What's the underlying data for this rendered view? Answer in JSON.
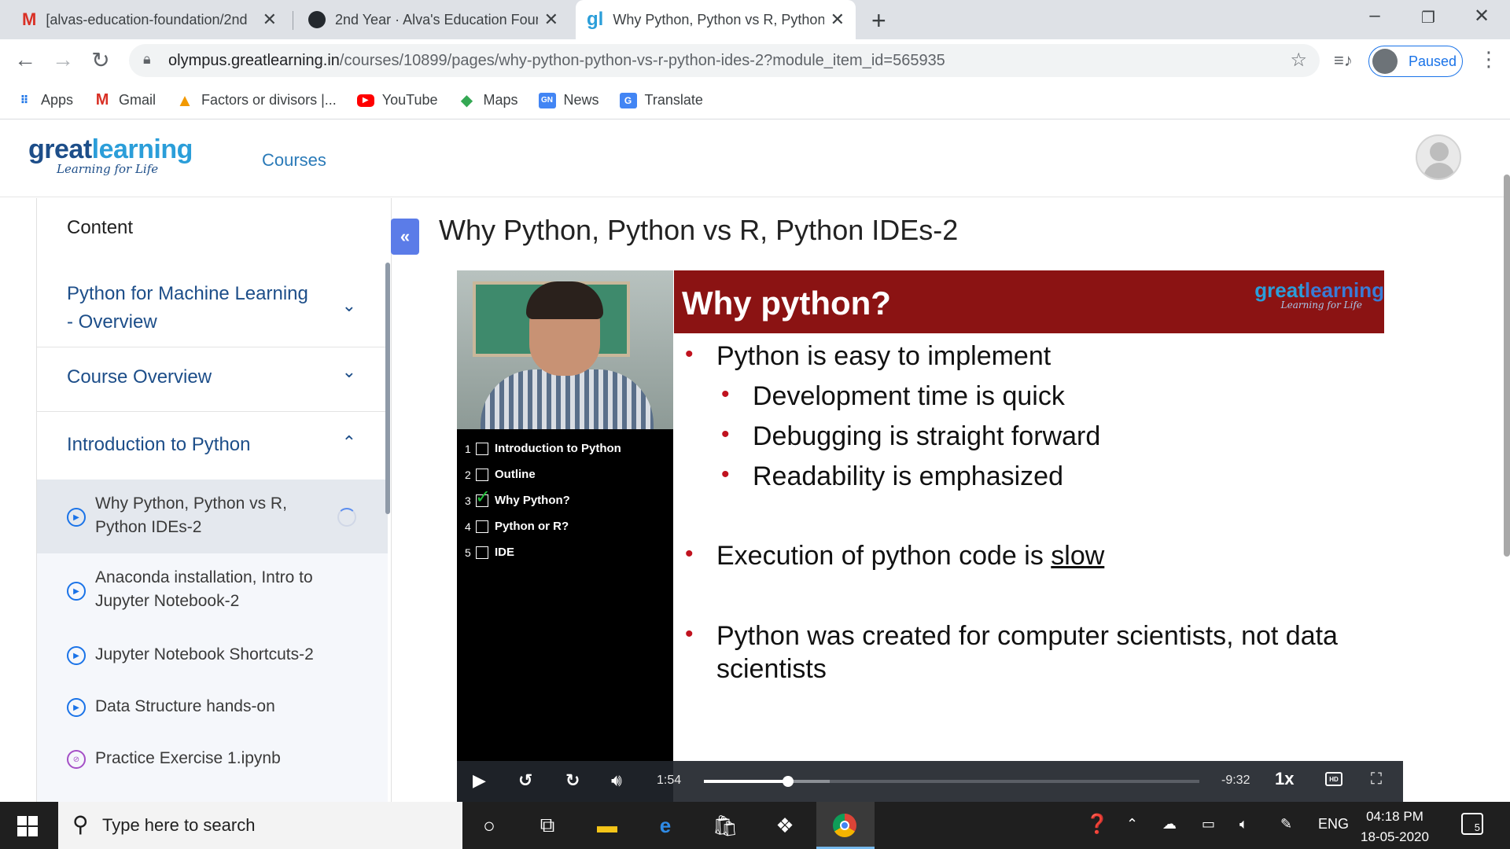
{
  "browser": {
    "tabs": [
      {
        "title": "[alvas-education-foundation/2nd",
        "icon": "gmail-icon"
      },
      {
        "title": "2nd Year · Alva's Education Found",
        "icon": "github-icon"
      },
      {
        "title": "Why Python, Python vs R, Python",
        "icon": "greatlearning-icon"
      }
    ],
    "new_tab": "+",
    "url_host": "olympus.greatlearning.in",
    "url_path": "/courses/10899/pages/why-python-python-vs-r-python-ides-2?module_item_id=565935",
    "profile_status": "Paused",
    "bookmarks": [
      "Apps",
      "Gmail",
      "Factors or divisors |...",
      "YouTube",
      "Maps",
      "News",
      "Translate"
    ]
  },
  "site": {
    "logo_main": "great",
    "logo_accent": "learning",
    "logo_tagline": "Learning for Life",
    "nav_courses": "Courses"
  },
  "sidebar": {
    "title": "Content",
    "modules": [
      {
        "line1": "Python for Machine Learning",
        "line2": "- Overview",
        "expanded": false
      },
      {
        "line1": "Course Overview",
        "expanded": false
      },
      {
        "line1": "Introduction to Python",
        "expanded": true
      }
    ],
    "lessons": [
      {
        "line1": "Why Python, Python vs R,",
        "line2": "Python IDEs-2",
        "type": "video",
        "active": true
      },
      {
        "line1": "Anaconda installation, Intro to",
        "line2": "Jupyter Notebook-2",
        "type": "video"
      },
      {
        "line1": "Jupyter Notebook Shortcuts-2",
        "type": "video"
      },
      {
        "line1": "Data Structure hands-on",
        "type": "video"
      },
      {
        "line1": "Practice Exercise 1.ipynb",
        "type": "attachment"
      }
    ]
  },
  "main": {
    "collapse_label": "«",
    "title": "Why Python, Python vs R, Python IDEs-2"
  },
  "video": {
    "toc": [
      {
        "num": "1",
        "label": "Introduction to Python",
        "checked": false
      },
      {
        "num": "2",
        "label": "Outline",
        "checked": false
      },
      {
        "num": "3",
        "label": "Why Python?",
        "checked": true
      },
      {
        "num": "4",
        "label": "Python or R?",
        "checked": false
      },
      {
        "num": "5",
        "label": "IDE",
        "checked": false
      }
    ],
    "slide_title": "Why python?",
    "slide_logo_main": "great",
    "slide_logo_accent": "learning",
    "slide_logo_tagline": "Learning for Life",
    "bullets": {
      "b1": "Python is easy to implement",
      "b1a": "Development time is quick",
      "b1b": "Debugging is straight forward",
      "b1c": "Readability is emphasized",
      "b2_prefix": "Execution of python code is ",
      "b2_emph": "slow",
      "b3_line1": "Python was created for computer scientists, not data",
      "b3_line2": "scientists"
    },
    "elapsed": "1:54",
    "remaining": "-9:32",
    "speed": "1x",
    "hd": "HD",
    "progress_fraction": 0.17
  },
  "taskbar": {
    "search_placeholder": "Type here to search",
    "language": "ENG",
    "time": "04:18 PM",
    "date": "18-05-2020",
    "notifications": "5"
  },
  "colors": {
    "brand_dark": "#1d4e89",
    "brand_light": "#2b9ed9",
    "slide_header": "#8b1313",
    "bullet_red": "#c0121e",
    "accent_blue": "#5b7ce8"
  }
}
